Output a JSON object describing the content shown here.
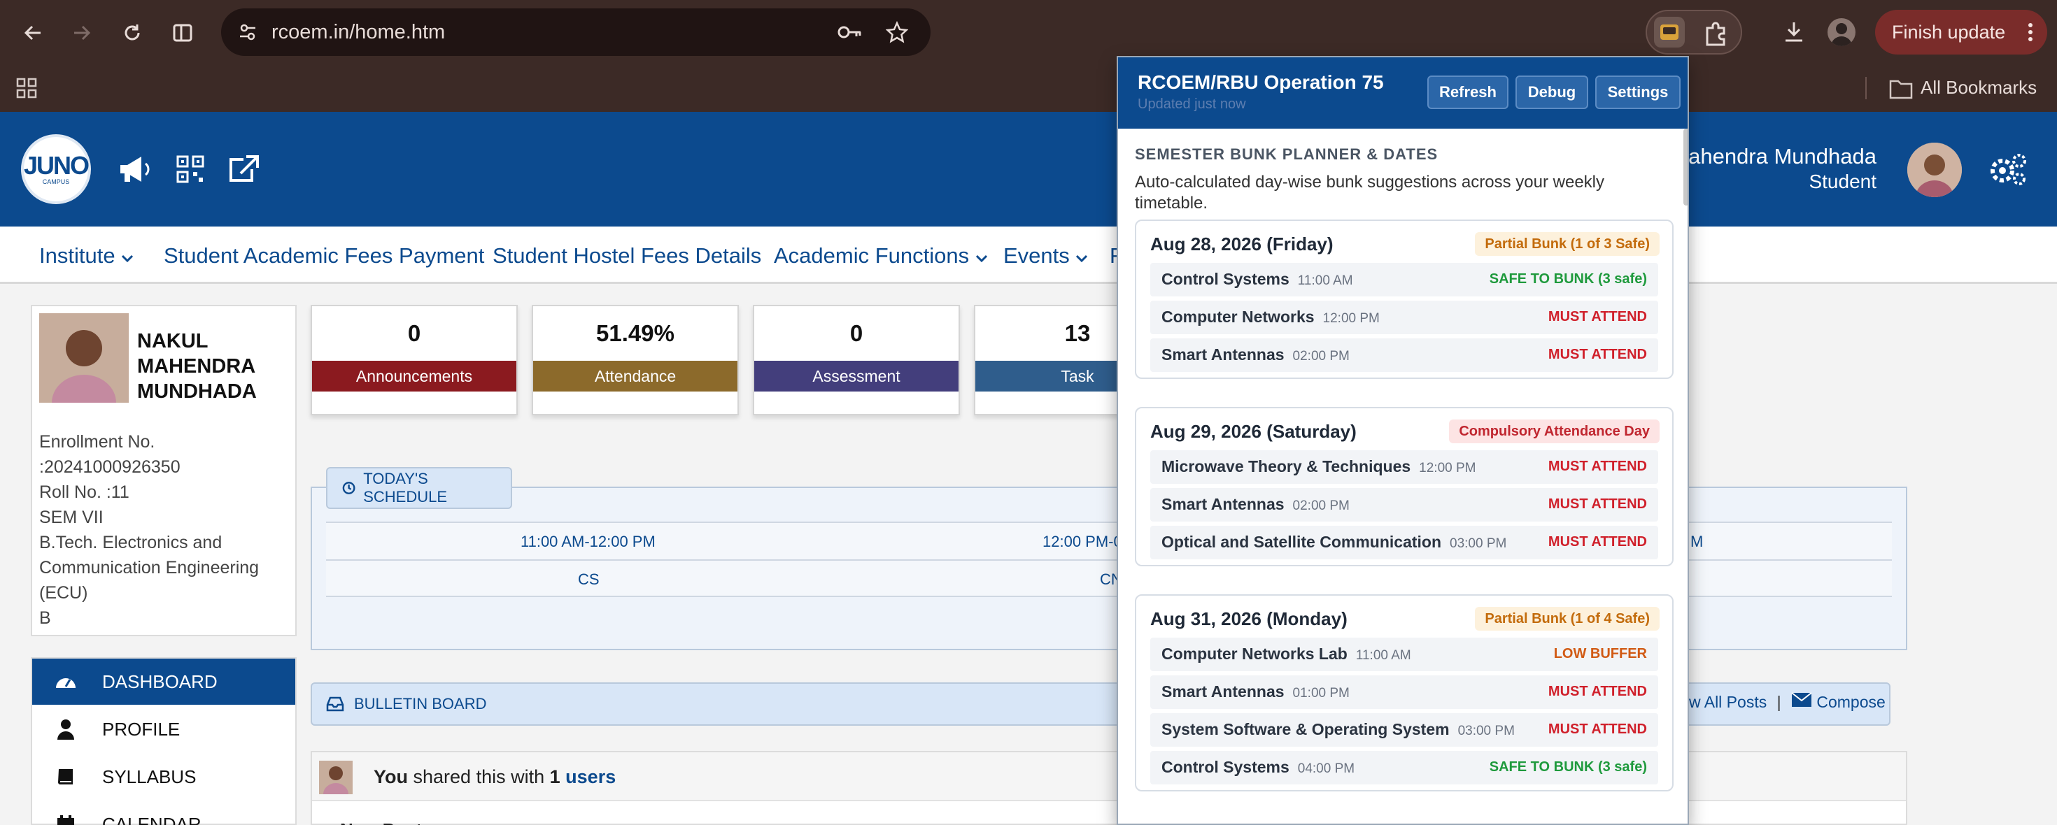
{
  "browser": {
    "url": "rcoem.in/home.htm",
    "finish_update": "Finish update",
    "all_bookmarks": "All Bookmarks"
  },
  "site": {
    "logo_text": "JUNO",
    "logo_subtext": "CAMPUS",
    "user_name": "Mahendra Mundhada",
    "user_role": "Student",
    "menu": [
      {
        "label": "Institute"
      },
      {
        "label": "Student Academic Fees Payment"
      },
      {
        "label": "Student Hostel Fees Details"
      },
      {
        "label": "Academic Functions"
      },
      {
        "label": "Events"
      },
      {
        "label": "F"
      }
    ]
  },
  "profile": {
    "name": "NAKUL MAHENDRA MUNDHADA",
    "lines": [
      "Enrollment No.",
      ":20241000926350",
      "Roll No. :11",
      "SEM VII",
      "B.Tech. Electronics and",
      "Communication Engineering",
      "(ECU)",
      "B"
    ]
  },
  "sidebar": {
    "items": [
      {
        "label": "DASHBOARD",
        "icon": "dashboard-icon"
      },
      {
        "label": "PROFILE",
        "icon": "user-icon"
      },
      {
        "label": "SYLLABUS",
        "icon": "book-icon"
      },
      {
        "label": "CALENDAR",
        "icon": "calendar-icon"
      }
    ]
  },
  "stats": [
    {
      "value": "0",
      "label": "Announcements",
      "color": "#8b1a1f"
    },
    {
      "value": "51.49%",
      "label": "Attendance",
      "color": "#8c6a2b"
    },
    {
      "value": "0",
      "label": "Assessment",
      "color": "#433e7c"
    },
    {
      "value": "13",
      "label": "Task",
      "color": "#2f5d8c"
    }
  ],
  "schedule": {
    "tab_label": "TODAY'S SCHEDULE",
    "times": [
      "11:00 AM-12:00 PM",
      "12:00 PM-0",
      "M"
    ],
    "subjects": [
      "CS",
      "CN",
      ""
    ]
  },
  "bulletin": {
    "label": "BULLETIN BOARD",
    "view_all": "w All Posts",
    "separator": "|",
    "compose": "Compose",
    "post_you": "You",
    "post_shared": "shared this with",
    "post_count": "1",
    "post_users": "users",
    "post_sub": "New Post"
  },
  "popup": {
    "title": "RCOEM/RBU Operation 75",
    "updated": "Updated just now",
    "buttons": {
      "refresh": "Refresh",
      "debug": "Debug",
      "settings": "Settings"
    },
    "section_title": "SEMESTER BUNK PLANNER & DATES",
    "section_desc": "Auto-calculated day-wise bunk suggestions across your weekly timetable.",
    "days": [
      {
        "date": "Aug 28, 2026 (Friday)",
        "badge": "Partial Bunk (1 of 3 Safe)",
        "badge_type": "partial",
        "classes": [
          {
            "name": "Control Systems",
            "time": "11:00 AM",
            "status": "SAFE TO BUNK (3 safe)",
            "type": "safe"
          },
          {
            "name": "Computer Networks",
            "time": "12:00 PM",
            "status": "MUST ATTEND",
            "type": "must"
          },
          {
            "name": "Smart Antennas",
            "time": "02:00 PM",
            "status": "MUST ATTEND",
            "type": "must"
          }
        ]
      },
      {
        "date": "Aug 29, 2026 (Saturday)",
        "badge": "Compulsory Attendance Day",
        "badge_type": "compulsory",
        "classes": [
          {
            "name": "Microwave Theory & Techniques",
            "time": "12:00 PM",
            "status": "MUST ATTEND",
            "type": "must"
          },
          {
            "name": "Smart Antennas",
            "time": "02:00 PM",
            "status": "MUST ATTEND",
            "type": "must"
          },
          {
            "name": "Optical and Satellite Communication",
            "time": "03:00 PM",
            "status": "MUST ATTEND",
            "type": "must"
          }
        ]
      },
      {
        "date": "Aug 31, 2026 (Monday)",
        "badge": "Partial Bunk (1 of 4 Safe)",
        "badge_type": "partial",
        "classes": [
          {
            "name": "Computer Networks Lab",
            "time": "11:00 AM",
            "status": "LOW BUFFER",
            "type": "low"
          },
          {
            "name": "Smart Antennas",
            "time": "01:00 PM",
            "status": "MUST ATTEND",
            "type": "must"
          },
          {
            "name": "System Software & Operating System",
            "time": "03:00 PM",
            "status": "MUST ATTEND",
            "type": "must"
          },
          {
            "name": "Control Systems",
            "time": "04:00 PM",
            "status": "SAFE TO BUNK (3 safe)",
            "type": "safe"
          }
        ]
      }
    ]
  }
}
